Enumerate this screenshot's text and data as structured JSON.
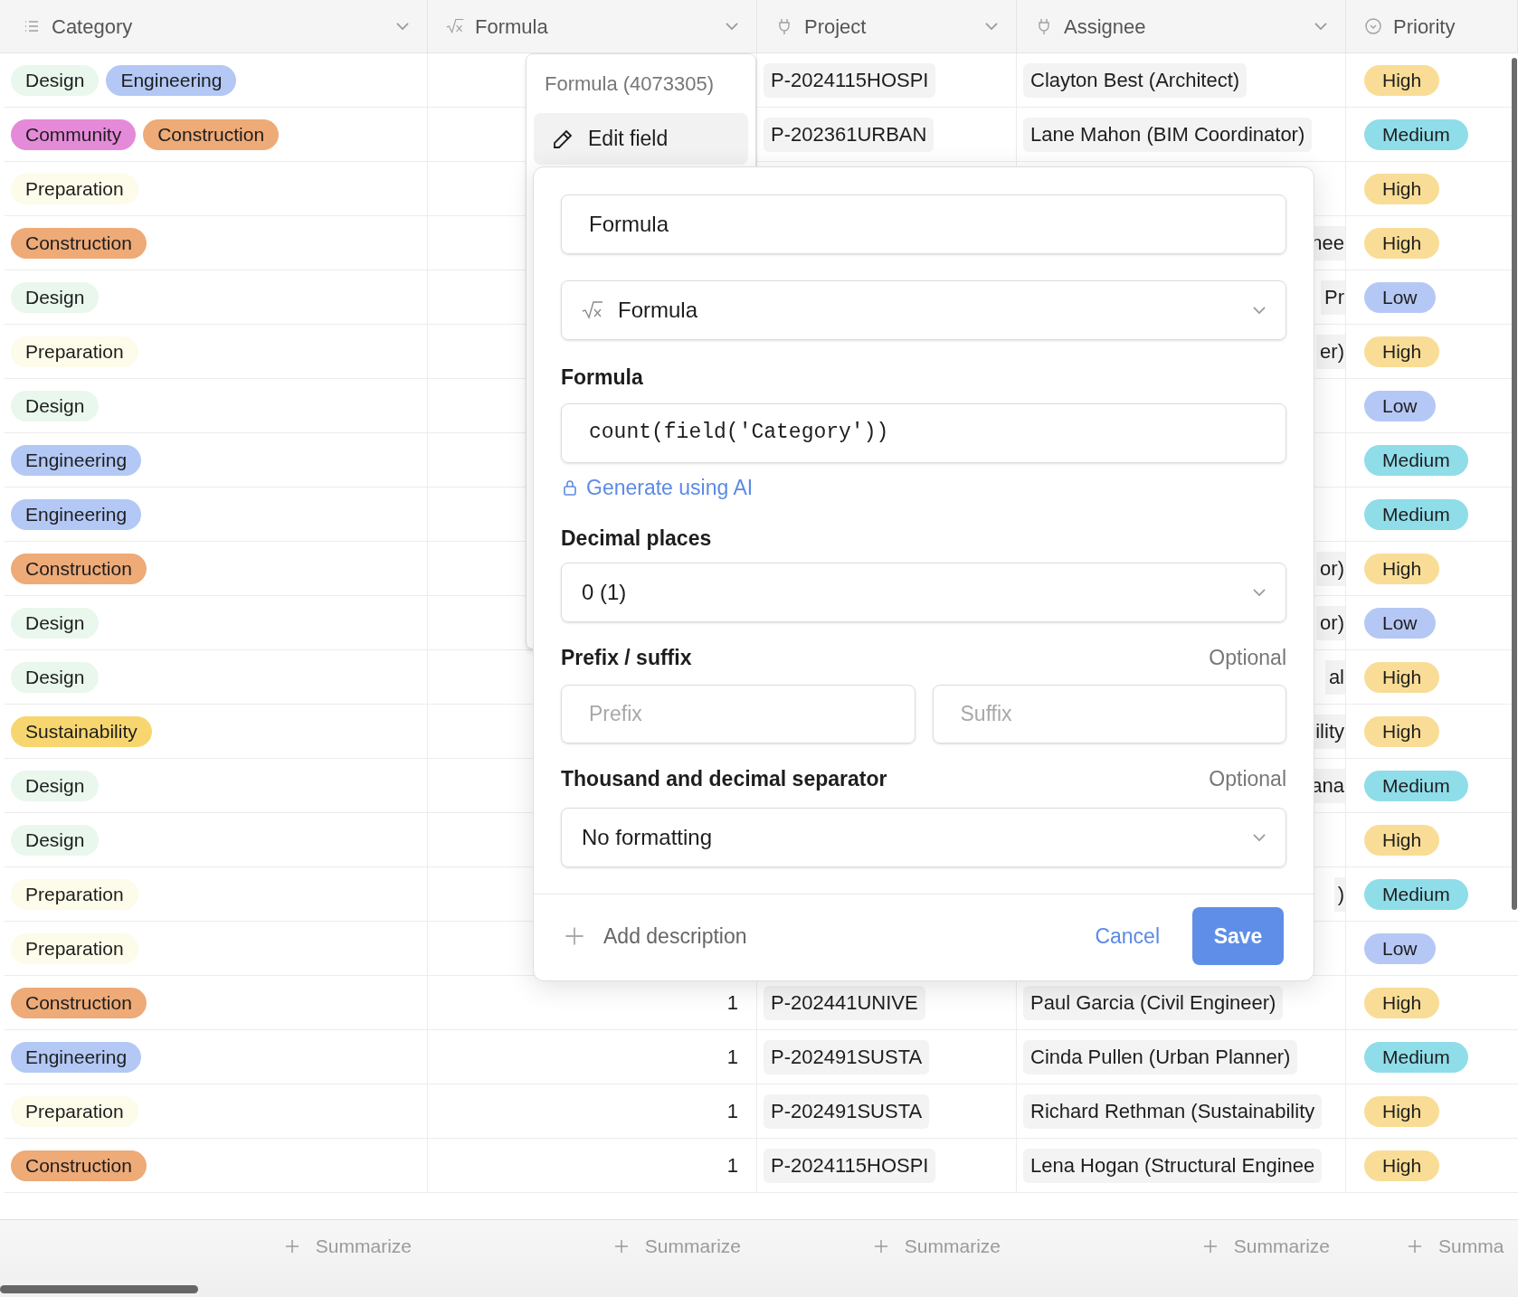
{
  "table": {
    "columns": [
      {
        "label": "Category",
        "kind": "multi_select"
      },
      {
        "label": "Formula",
        "kind": "formula"
      },
      {
        "label": "Project",
        "kind": "link"
      },
      {
        "label": "Assignee",
        "kind": "link"
      },
      {
        "label": "Priority",
        "kind": "single_select"
      }
    ],
    "rows": [
      {
        "category": [
          {
            "label": "Design",
            "color": "#e9f7ec"
          },
          {
            "label": "Engineering",
            "color": "#b3c8f5"
          }
        ],
        "project": "P-2024115HOSPI",
        "assignee": {
          "text": "Clayton Best (Architect)",
          "partial": false
        },
        "priority": {
          "label": "High",
          "color": "#f9dd96"
        }
      },
      {
        "category": [
          {
            "label": "Community",
            "color": "#e48ad8"
          },
          {
            "label": "Construction",
            "color": "#eeaa77"
          }
        ],
        "project": "P-202361URBAN",
        "assignee": {
          "text": "Lane Mahon (BIM Coordinator)",
          "partial": false
        },
        "priority": {
          "label": "Medium",
          "color": "#8fdde9"
        }
      },
      {
        "category": [
          {
            "label": "Preparation",
            "color": "#fdfbe9"
          }
        ],
        "priority": {
          "label": "High",
          "color": "#f9dd96"
        }
      },
      {
        "category": [
          {
            "label": "Construction",
            "color": "#eeaa77"
          }
        ],
        "assignee": {
          "text": "nee",
          "partial": true
        },
        "priority": {
          "label": "High",
          "color": "#f9dd96"
        }
      },
      {
        "category": [
          {
            "label": "Design",
            "color": "#e9f7ec"
          }
        ],
        "assignee": {
          "text": "Pr",
          "partial": true
        },
        "priority": {
          "label": "Low",
          "color": "#b5c8f5"
        }
      },
      {
        "category": [
          {
            "label": "Preparation",
            "color": "#fdfbe9"
          }
        ],
        "assignee": {
          "text": "er)",
          "partial": true
        },
        "priority": {
          "label": "High",
          "color": "#f9dd96"
        }
      },
      {
        "category": [
          {
            "label": "Design",
            "color": "#e9f7ec"
          }
        ],
        "priority": {
          "label": "Low",
          "color": "#b5c8f5"
        }
      },
      {
        "category": [
          {
            "label": "Engineering",
            "color": "#b3c8f5"
          }
        ],
        "priority": {
          "label": "Medium",
          "color": "#8fdde9"
        }
      },
      {
        "category": [
          {
            "label": "Engineering",
            "color": "#b3c8f5"
          }
        ],
        "priority": {
          "label": "Medium",
          "color": "#8fdde9"
        }
      },
      {
        "category": [
          {
            "label": "Construction",
            "color": "#eeaa77"
          }
        ],
        "assignee": {
          "text": "or)",
          "partial": true
        },
        "priority": {
          "label": "High",
          "color": "#f9dd96"
        }
      },
      {
        "category": [
          {
            "label": "Design",
            "color": "#e9f7ec"
          }
        ],
        "assignee": {
          "text": "or)",
          "partial": true
        },
        "priority": {
          "label": "Low",
          "color": "#b5c8f5"
        }
      },
      {
        "category": [
          {
            "label": "Design",
            "color": "#e9f7ec"
          }
        ],
        "assignee": {
          "text": "al",
          "partial": true
        },
        "priority": {
          "label": "High",
          "color": "#f9dd96"
        }
      },
      {
        "category": [
          {
            "label": "Sustainability",
            "color": "#f7d670"
          }
        ],
        "assignee": {
          "text": "ility",
          "partial": true
        },
        "priority": {
          "label": "High",
          "color": "#f9dd96"
        }
      },
      {
        "category": [
          {
            "label": "Design",
            "color": "#e9f7ec"
          }
        ],
        "assignee": {
          "text": "ana",
          "partial": true
        },
        "priority": {
          "label": "Medium",
          "color": "#8fdde9"
        }
      },
      {
        "category": [
          {
            "label": "Design",
            "color": "#e9f7ec"
          }
        ],
        "priority": {
          "label": "High",
          "color": "#f9dd96"
        }
      },
      {
        "category": [
          {
            "label": "Preparation",
            "color": "#fdfbe9"
          }
        ],
        "assignee": {
          "text": ")",
          "partial": true
        },
        "priority": {
          "label": "Medium",
          "color": "#8fdde9"
        }
      },
      {
        "category": [
          {
            "label": "Preparation",
            "color": "#fdfbe9"
          }
        ],
        "priority": {
          "label": "Low",
          "color": "#b5c8f5"
        }
      },
      {
        "category": [
          {
            "label": "Construction",
            "color": "#eeaa77"
          }
        ],
        "formula": "1",
        "project": "P-202441UNIVE",
        "assignee": {
          "text": "Paul Garcia (Civil Engineer)",
          "partial": false
        },
        "priority": {
          "label": "High",
          "color": "#f9dd96"
        }
      },
      {
        "category": [
          {
            "label": "Engineering",
            "color": "#b3c8f5"
          }
        ],
        "formula": "1",
        "project": "P-202491SUSTA",
        "assignee": {
          "text": "Cinda Pullen (Urban Planner)",
          "partial": false
        },
        "priority": {
          "label": "Medium",
          "color": "#8fdde9"
        }
      },
      {
        "category": [
          {
            "label": "Preparation",
            "color": "#fdfbe9"
          }
        ],
        "formula": "1",
        "project": "P-202491SUSTA",
        "assignee": {
          "text": "Richard Rethman (Sustainability",
          "partial": false
        },
        "priority": {
          "label": "High",
          "color": "#f9dd96"
        }
      },
      {
        "category": [
          {
            "label": "Construction",
            "color": "#eeaa77"
          }
        ],
        "formula": "1",
        "project": "P-2024115HOSPI",
        "assignee": {
          "text": "Lena Hogan (Structural Enginee",
          "partial": false
        },
        "priority": {
          "label": "High",
          "color": "#f9dd96"
        }
      }
    ],
    "footer": [
      "Summarize",
      "Summarize",
      "Summarize",
      "Summarize",
      "Summa"
    ]
  },
  "field_menu": {
    "title": "Formula (4073305)",
    "items": [
      {
        "label": "Edit field",
        "selected": true
      }
    ]
  },
  "edit_dialog": {
    "name": "Formula",
    "type": "Formula",
    "formula_label": "Formula",
    "formula": "count(field('Category'))",
    "ai_link": "Generate using AI",
    "decimal_label": "Decimal places",
    "decimal": "0 (1)",
    "affix_label": "Prefix / suffix",
    "affix_optional": "Optional",
    "prefix_placeholder": "Prefix",
    "suffix_placeholder": "Suffix",
    "separator_label": "Thousand and decimal separator",
    "separator_optional": "Optional",
    "separator": "No formatting",
    "add_description": "Add description",
    "cancel": "Cancel",
    "save": "Save"
  }
}
